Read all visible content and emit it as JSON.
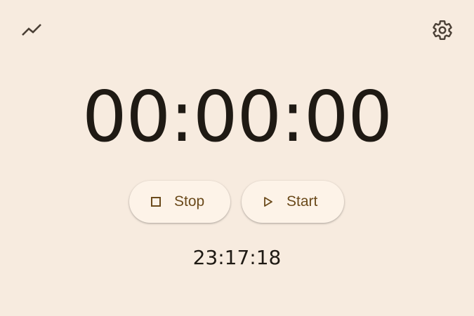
{
  "header": {
    "stats_icon": "trending-up-icon",
    "settings_icon": "gear-icon"
  },
  "timer": {
    "display": "00:00:00"
  },
  "controls": {
    "stop_label": "Stop",
    "stop_icon": "stop-square-icon",
    "start_label": "Start",
    "start_icon": "play-triangle-icon"
  },
  "clock": {
    "time": "23:17:18"
  },
  "colors": {
    "background": "#f7ebdf",
    "button_bg": "#fdf3e8",
    "accent": "#6b4a1b",
    "text": "#1f1a14"
  }
}
